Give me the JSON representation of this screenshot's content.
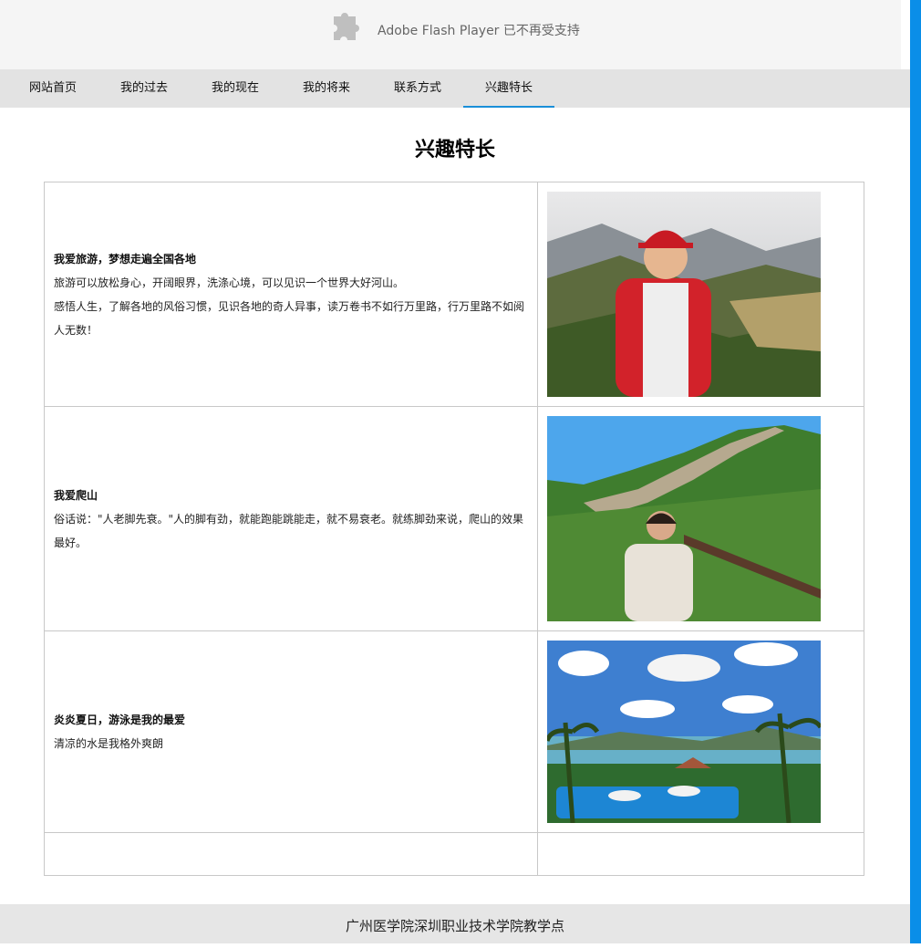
{
  "flash_notice": {
    "text": "Adobe Flash Player 已不再受支持"
  },
  "nav": {
    "items": [
      {
        "label": "网站首页"
      },
      {
        "label": "我的过去"
      },
      {
        "label": "我的现在"
      },
      {
        "label": "我的将来"
      },
      {
        "label": "联系方式"
      },
      {
        "label": "兴趣特长"
      }
    ],
    "active_index": 5
  },
  "page": {
    "title": "兴趣特长"
  },
  "hobbies": [
    {
      "heading": "我爱旅游，梦想走遍全国各地",
      "lines": [
        "旅游可以放松身心，开阔眼界，洗涤心境，可以见识一个世界大好河山。",
        "感悟人生，了解各地的风俗习惯，见识各地的奇人异事，读万卷书不如行万里路，行万里路不如阅人无数！"
      ]
    },
    {
      "heading": "我爱爬山",
      "lines": [
        "俗话说：\"人老脚先衰。\"人的脚有劲，就能跑能跳能走，就不易衰老。就练脚劲来说，爬山的效果最好。"
      ]
    },
    {
      "heading": "炎炎夏日，游泳是我的最爱",
      "lines": [
        "清凉的水是我格外爽朗"
      ]
    }
  ],
  "footer": {
    "text": "广州医学院深圳职业技术学院教学点"
  },
  "colors": {
    "accent": "#1a8fd8",
    "scrollbar": "#0a8ee8",
    "nav_bg": "#e3e3e3",
    "footer_bg": "#e6e6e6"
  }
}
